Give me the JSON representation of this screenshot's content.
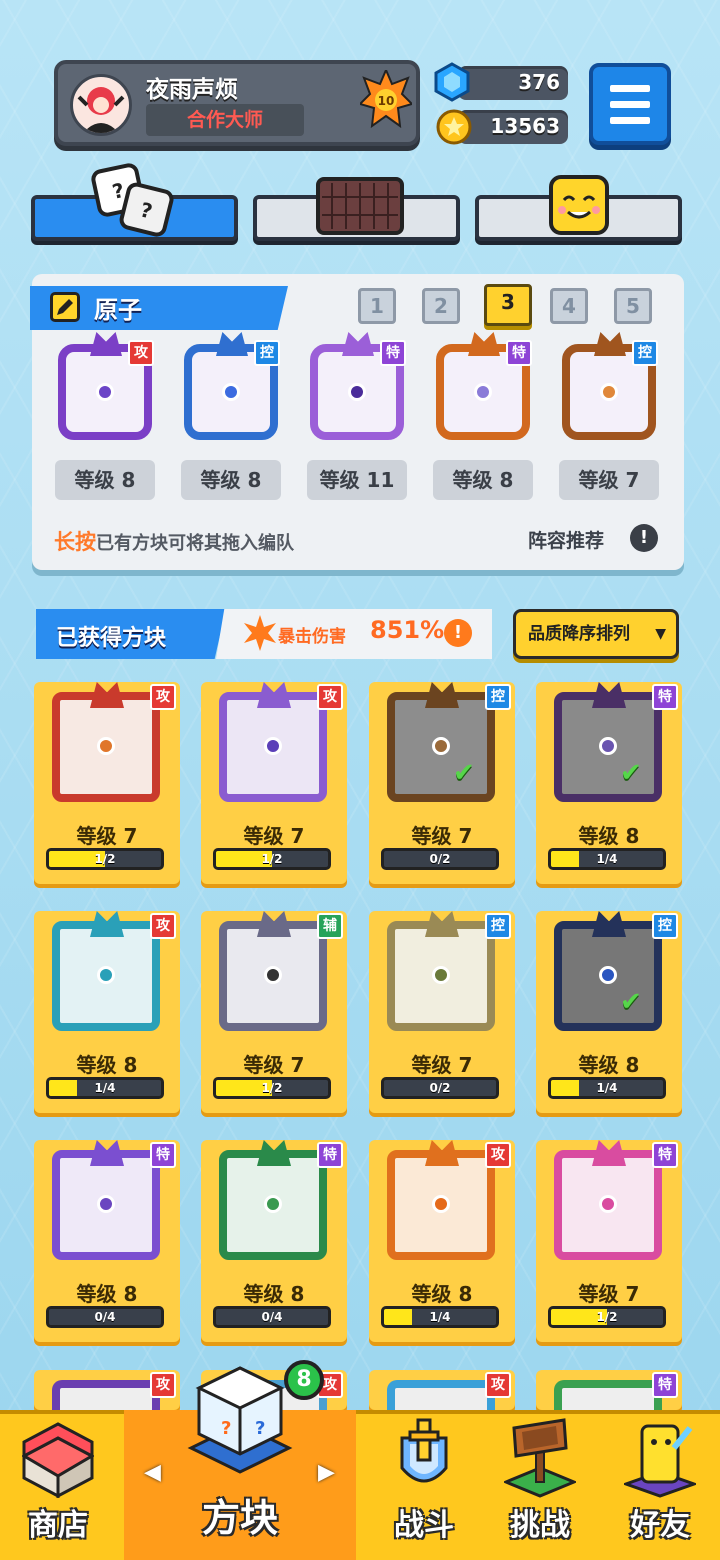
{
  "profile": {
    "name": "夜雨声烦",
    "title": "合作大师",
    "level_badge": "10"
  },
  "currency": {
    "gems": "376",
    "coins": "13563"
  },
  "deck": {
    "title": "原子",
    "slots": [
      "1",
      "2",
      "3",
      "4",
      "5"
    ],
    "active_slot": "3",
    "blocks": [
      {
        "tag": "攻",
        "tag_color": "#e53935",
        "level": "等级 8",
        "frame": "#7b3fc6",
        "orb": "#6c45c7"
      },
      {
        "tag": "控",
        "tag_color": "#1e88e5",
        "level": "等级 8",
        "frame": "#2f6fd0",
        "orb": "#3c6be0"
      },
      {
        "tag": "特",
        "tag_color": "#8e44d6",
        "level": "等级 11",
        "frame": "#9b5fd8",
        "orb": "#4b2d9a"
      },
      {
        "tag": "特",
        "tag_color": "#8e44d6",
        "level": "等级 8",
        "frame": "#d2691e",
        "orb": "#8a7bd8"
      },
      {
        "tag": "控",
        "tag_color": "#1e88e5",
        "level": "等级 7",
        "frame": "#a0551f",
        "orb": "#e0883a"
      }
    ],
    "hint_prefix": "长按",
    "hint_rest": "已有方块可将其拖入编队",
    "recommend": "阵容推荐",
    "recommend_icon": "!"
  },
  "owned": {
    "title": "已获得方块",
    "crit_label": "暴击伤害",
    "crit_value": "851%",
    "crit_icon": "!",
    "sort_label": "品质降序排列",
    "cards": [
      {
        "tag": "攻",
        "tag_color": "#e53935",
        "level": "等级 7",
        "progress": "1/2",
        "frac": 0.5,
        "frame": "#c93a2c",
        "bg": "#f7e9e3",
        "orb": "#e0762a",
        "checked": false
      },
      {
        "tag": "攻",
        "tag_color": "#e53935",
        "level": "等级 7",
        "progress": "1/2",
        "frac": 0.5,
        "frame": "#8a5cd0",
        "bg": "#ece6f5",
        "orb": "#5b3fb8",
        "checked": false
      },
      {
        "tag": "控",
        "tag_color": "#1e88e5",
        "level": "等级 7",
        "progress": "0/2",
        "frac": 0,
        "frame": "#6b4420",
        "bg": "#8d8d8d",
        "orb": "#9a6a3a",
        "checked": true
      },
      {
        "tag": "特",
        "tag_color": "#8e44d6",
        "level": "等级 8",
        "progress": "1/4",
        "frac": 0.25,
        "frame": "#4a2f66",
        "bg": "#8a8a8a",
        "orb": "#6a55b0",
        "checked": true
      },
      {
        "tag": "攻",
        "tag_color": "#e53935",
        "level": "等级 8",
        "progress": "1/4",
        "frac": 0.25,
        "frame": "#2aa0b8",
        "bg": "#e3f2f4",
        "orb": "#2aa0b8",
        "checked": false
      },
      {
        "tag": "辅",
        "tag_color": "#27a35a",
        "level": "等级 7",
        "progress": "1/2",
        "frac": 0.5,
        "frame": "#6a6a88",
        "bg": "#e9e9ef",
        "orb": "#333333",
        "checked": false
      },
      {
        "tag": "控",
        "tag_color": "#1e88e5",
        "level": "等级 7",
        "progress": "0/2",
        "frac": 0,
        "frame": "#9a8a55",
        "bg": "#f1eedf",
        "orb": "#6a7a3a",
        "checked": false
      },
      {
        "tag": "控",
        "tag_color": "#1e88e5",
        "level": "等级 8",
        "progress": "1/4",
        "frac": 0.25,
        "frame": "#24325a",
        "bg": "#777777",
        "orb": "#2a55c0",
        "checked": true
      },
      {
        "tag": "特",
        "tag_color": "#8e44d6",
        "level": "等级 8",
        "progress": "0/4",
        "frac": 0,
        "frame": "#7b4fd0",
        "bg": "#efe9f8",
        "orb": "#6a45c0",
        "checked": false
      },
      {
        "tag": "特",
        "tag_color": "#8e44d6",
        "level": "等级 8",
        "progress": "0/4",
        "frac": 0,
        "frame": "#2a8a4a",
        "bg": "#e6f2ea",
        "orb": "#3a9a50",
        "checked": false
      },
      {
        "tag": "攻",
        "tag_color": "#e53935",
        "level": "等级 8",
        "progress": "1/4",
        "frac": 0.25,
        "frame": "#e0701e",
        "bg": "#fbe9d6",
        "orb": "#e56a1a",
        "checked": false
      },
      {
        "tag": "特",
        "tag_color": "#8e44d6",
        "level": "等级 7",
        "progress": "1/2",
        "frac": 0.5,
        "frame": "#d94ca0",
        "bg": "#f8e6f1",
        "orb": "#d94ca0",
        "checked": false
      }
    ],
    "partial_row": [
      {
        "tag": "攻",
        "tag_color": "#e53935",
        "frame": "#6a3fb0"
      },
      {
        "tag": "攻",
        "tag_color": "#e53935",
        "frame": "#4aa0d0"
      },
      {
        "tag": "攻",
        "tag_color": "#e53935",
        "frame": "#3aa0d8"
      },
      {
        "tag": "特",
        "tag_color": "#8e44d6",
        "frame": "#3aa050"
      }
    ]
  },
  "nav": {
    "shop": "商店",
    "blocks": "方块",
    "blocks_badge": "8",
    "battle": "战斗",
    "challenge": "挑战",
    "friends": "好友",
    "prev": "◀",
    "next": "▶"
  }
}
